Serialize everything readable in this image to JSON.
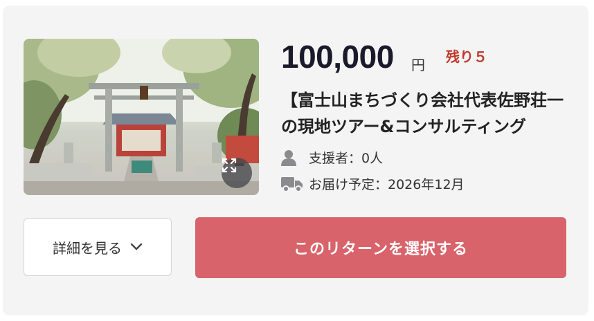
{
  "reward": {
    "image_alt": "shrine-torii-photo",
    "price": "100,000",
    "currency": "円",
    "remaining": "残り５",
    "title": "【富士山まちづくり会社代表佐野荘一の現地ツアー&コンサルティング",
    "supporters": "支援者：0人",
    "delivery": "お届け予定：2026年12月",
    "details_label": "詳細を見る",
    "select_label": "このリターンを選択する"
  },
  "icons": {
    "expand": "expand-arrows-icon",
    "person": "person-icon",
    "truck": "truck-icon",
    "chevron": "chevron-down-icon"
  },
  "colors": {
    "accent_button": "#d8636a",
    "remaining_text": "#c0392b",
    "card_bg": "#f4f4f5"
  }
}
